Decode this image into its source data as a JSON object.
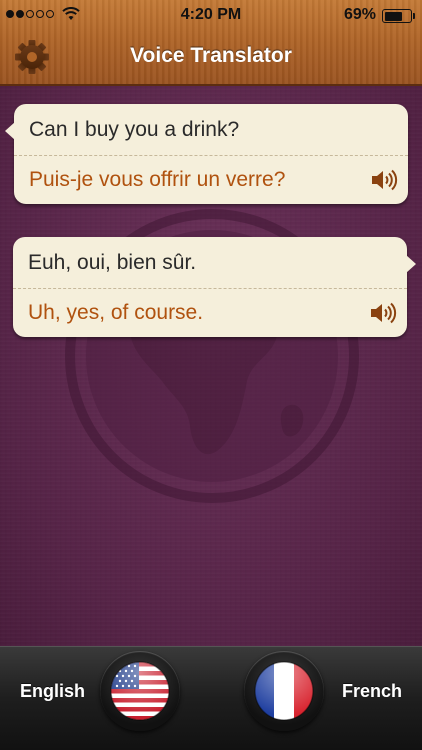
{
  "status": {
    "time": "4:20 PM",
    "battery": "69%",
    "battery_level": 0.69,
    "signal_bars": 2
  },
  "nav": {
    "title": "Voice Translator",
    "settings_icon": "gear-icon"
  },
  "conversation": [
    {
      "source": "Can I buy you a drink?",
      "translation": "Puis-je vous offrir un verre?",
      "side": "left"
    },
    {
      "source": "Euh, oui, bien sûr.",
      "translation": "Uh, yes, of course.",
      "side": "right"
    }
  ],
  "languages": {
    "left": {
      "label": "English",
      "flag": "us-flag-icon"
    },
    "right": {
      "label": "French",
      "flag": "france-flag-icon"
    }
  },
  "colors": {
    "nav_wood": "#b06528",
    "background": "#5a2a4d",
    "bubble": "#f5efdb",
    "translation_text": "#b0520f",
    "bottom_bar": "#1e1e1e"
  }
}
